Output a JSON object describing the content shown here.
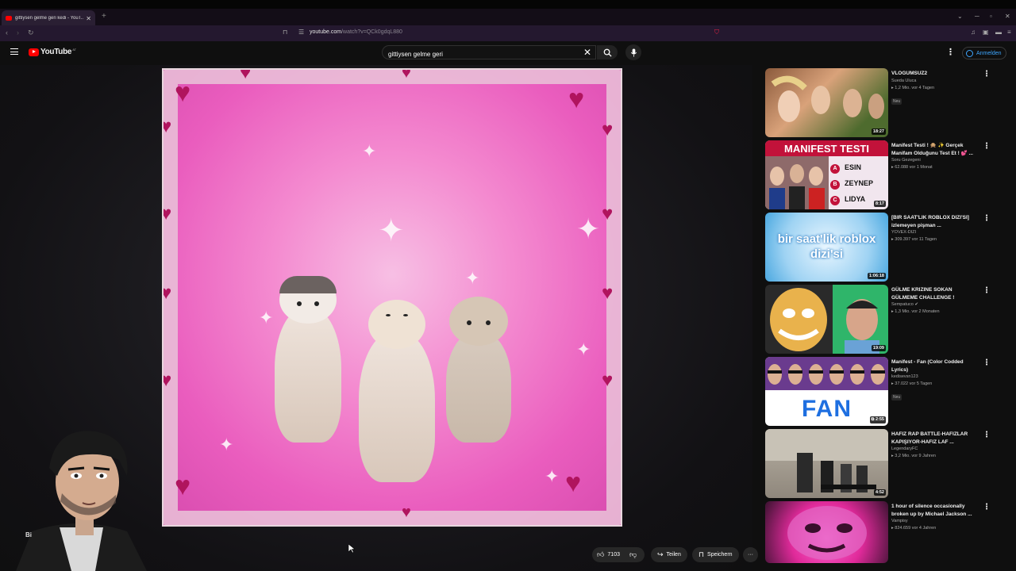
{
  "browser": {
    "tab_title": "gittiysen gelme geri kedi - YouT...",
    "url_host": "youtube.com",
    "url_rest": "/watch?v=QCk0gdqL880"
  },
  "youtube": {
    "logo_text": "YouTube",
    "logo_region": "AT",
    "search_value": "gittiysen gelme geri",
    "signin_label": "Anmelden"
  },
  "actions": {
    "like_count": "7103",
    "share_label": "Teilen",
    "save_label": "Speichern"
  },
  "overlay_text": "Bi",
  "sidebar": [
    {
      "title": "VLOGUMSUZ2",
      "channel": "Sueda Ulucа",
      "stats": "1,2 Mio.  vor 4 Tagen",
      "badge": "Neu",
      "duration": "18:27"
    },
    {
      "title": "Manifest Testi ! 🙊 ✨ Gerçek Manifam Olduğunu Test Et ! 💕 ...",
      "channel": "Soru Gezegeni",
      "stats": "62.088  vor 1 Monat",
      "badge": "",
      "duration": "8:17",
      "thumb_text": [
        "MANIFEST TESTI",
        "ESIN",
        "ZEYNEP",
        "LIDYA"
      ]
    },
    {
      "title": "[BIR SAAT'LIK ROBLOX DIZI'SI] izlemeyen pişman ...",
      "channel": "YOVEX-DIZI",
      "stats": "309.397  vor 11 Tagen",
      "badge": "",
      "duration": "1:06:18",
      "thumb_text": "bir saat'lik roblox dizi'si"
    },
    {
      "title": "GÜLME KRIZINE SOKAN GÜLMEME CHALLENGE !",
      "channel": "Sempatuco",
      "stats": "1,3 Mio.  vor 2 Monaten",
      "badge": "",
      "duration": "19:09"
    },
    {
      "title": "Manifest - Fan (Color Codded Lyrics)",
      "channel": "kedisevsn123",
      "stats": "37.022  vor 5 Tagen",
      "badge": "Neu",
      "duration": "2:55",
      "thumb_text": "FAN"
    },
    {
      "title": "HAFIZ RAP BATTLE-HAFIZLAR KAPIŞIYOR-HAFIZ LAF ...",
      "channel": "LegendaryFC",
      "stats": "3,2 Mio.  vor 9 Jahren",
      "badge": "",
      "duration": "4:52"
    },
    {
      "title": "1 hour of silence occasionally broken up by Michael Jackson ...",
      "channel": "Vampisy",
      "stats": "824.659  vor 4 Jahren",
      "badge": "",
      "duration": ""
    }
  ]
}
